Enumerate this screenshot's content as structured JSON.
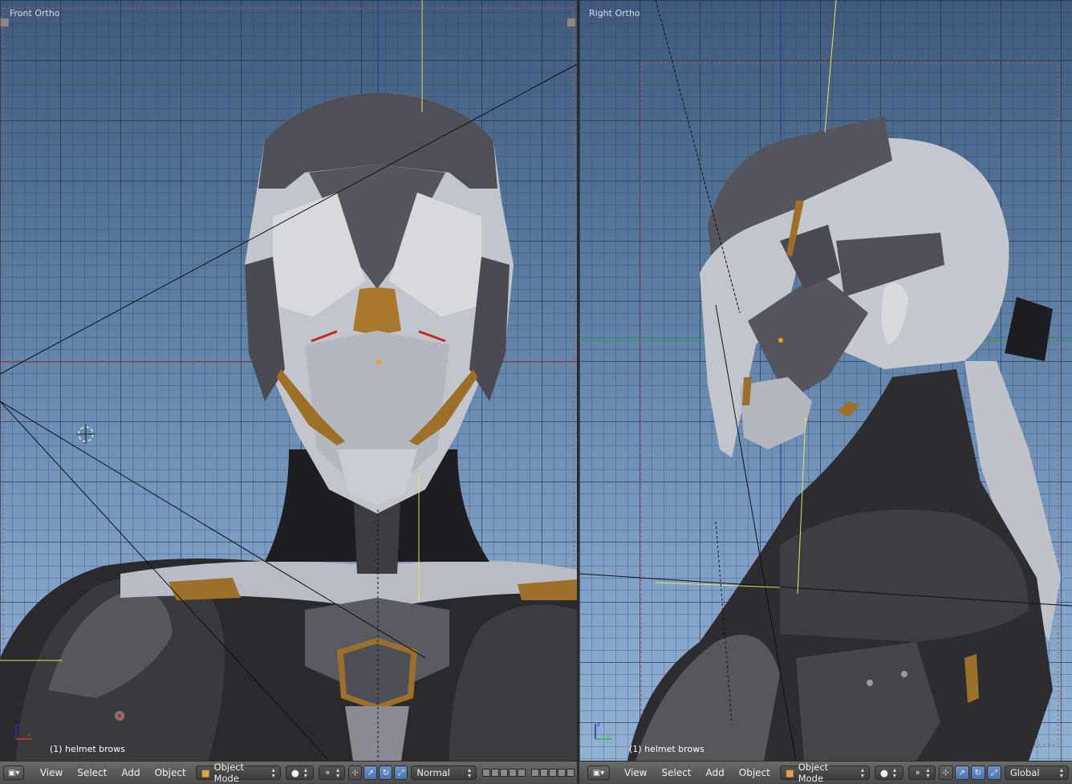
{
  "viewports": {
    "left": {
      "view_label": "Front Ortho",
      "object_label": "(1) helmet brows"
    },
    "right": {
      "view_label": "Right Ortho",
      "object_label": "(1) helmet brows"
    }
  },
  "header_left": {
    "menus": [
      "View",
      "Select",
      "Add",
      "Object"
    ],
    "mode": "Object Mode",
    "pivot_orientation": "Normal"
  },
  "header_right": {
    "menus": [
      "View",
      "Select",
      "Add",
      "Object"
    ],
    "mode": "Object Mode",
    "pivot_orientation": "Global"
  },
  "colors": {
    "viewport_top": "#3f5a7d",
    "viewport_bottom": "#93b1d4",
    "header_bg": "#555555",
    "x_axis": "#c83c3c",
    "y_axis": "#3cb43c",
    "z_axis": "#2d2dbe",
    "active_button": "#5a84bd"
  }
}
